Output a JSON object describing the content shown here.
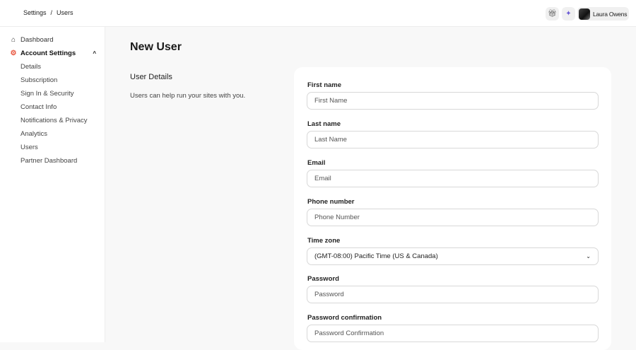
{
  "breadcrumb": [
    "Settings",
    "Users"
  ],
  "header": {
    "user_name": "Laura Owens"
  },
  "sidebar": {
    "dashboard": "Dashboard",
    "account_settings": "Account Settings",
    "items": [
      "Details",
      "Subscription",
      "Sign In & Security",
      "Contact Info",
      "Notifications & Privacy",
      "Analytics",
      "Users",
      "Partner Dashboard"
    ]
  },
  "page": {
    "title": "New User",
    "section_title": "User Details",
    "section_desc": "Users can help run your sites with you."
  },
  "form": {
    "fields": [
      {
        "label": "First name",
        "placeholder": "First Name"
      },
      {
        "label": "Last name",
        "placeholder": "Last Name"
      },
      {
        "label": "Email",
        "placeholder": "Email"
      },
      {
        "label": "Phone number",
        "placeholder": "Phone Number"
      },
      {
        "label": "Time zone",
        "value": "(GMT-08:00) Pacific Time (US & Canada)"
      },
      {
        "label": "Password",
        "placeholder": "Password"
      },
      {
        "label": "Password confirmation",
        "placeholder": "Password Confirmation"
      }
    ]
  },
  "colors": {
    "accent": "#e8553e",
    "wand": "#6b5bd6"
  }
}
